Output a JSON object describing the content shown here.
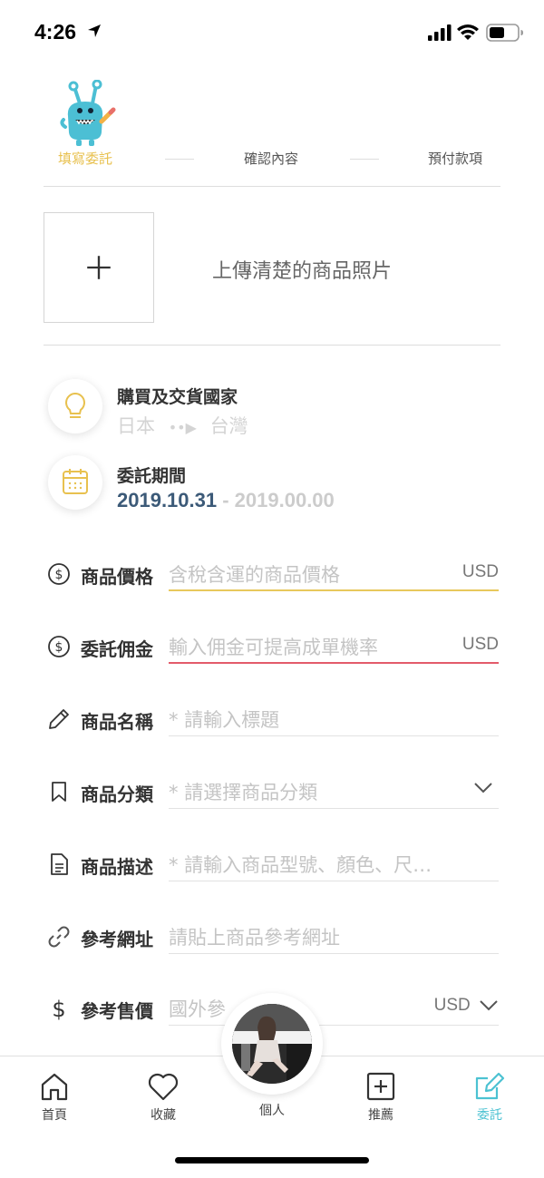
{
  "status_bar": {
    "time": "4:26"
  },
  "steps": [
    {
      "label": "填寫委託",
      "active": true
    },
    {
      "label": "確認內容",
      "active": false
    },
    {
      "label": "預付款項",
      "active": false
    }
  ],
  "upload": {
    "plus": "+",
    "text": "上傳清楚的商品照片"
  },
  "country": {
    "title": "購買及交貨國家",
    "from": "日本",
    "arrow": "••▶",
    "to": "台灣"
  },
  "period": {
    "title": "委託期間",
    "start": "2019.10.31",
    "sep": " - ",
    "end": "2019.00.00"
  },
  "form": {
    "price": {
      "label": "商品價格",
      "placeholder": "含稅含運的商品價格",
      "unit": "USD"
    },
    "commission": {
      "label": "委託佣金",
      "placeholder": "輸入佣金可提高成單機率",
      "unit": "USD"
    },
    "name": {
      "label": "商品名稱",
      "placeholder": "* 請輸入標題"
    },
    "category": {
      "label": "商品分類",
      "placeholder": "* 請選擇商品分類"
    },
    "description": {
      "label": "商品描述",
      "placeholder": "* 請輸入商品型號、顏色、尺…"
    },
    "url": {
      "label": "參考網址",
      "placeholder": "請貼上商品參考網址"
    },
    "ref_price": {
      "label": "參考售價",
      "placeholder": "國外參",
      "unit": "USD"
    }
  },
  "tabbar": {
    "home": "首頁",
    "favorites": "收藏",
    "profile": "個人",
    "recommend": "推薦",
    "commission": "委託"
  },
  "colors": {
    "accent_yellow": "#e8c14f",
    "accent_red": "#e35b6a",
    "accent_teal": "#4cc2d2",
    "date_blue": "#3c5a78"
  }
}
